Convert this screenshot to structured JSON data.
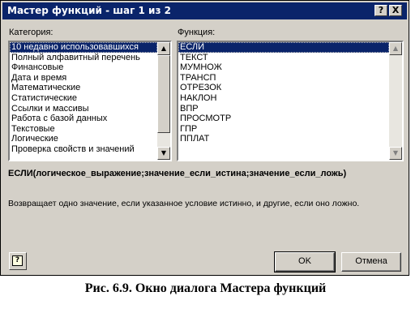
{
  "window": {
    "title": "Мастер функций - шаг 1 из 2",
    "help_glyph": "?",
    "close_glyph": "X"
  },
  "category": {
    "label": "Категория:",
    "items": [
      "10 недавно использовавшихся",
      "Полный алфавитный перечень",
      "Финансовые",
      "Дата и время",
      "Математические",
      "Статистические",
      "Ссылки и массивы",
      "Работа с базой данных",
      "Текстовые",
      "Логические",
      "Проверка свойств и значений"
    ],
    "selected_index": 0
  },
  "function": {
    "label": "Функция:",
    "items": [
      "ЕСЛИ",
      "ТЕКСТ",
      "МУМНОЖ",
      "ТРАНСП",
      "ОТРЕЗОК",
      "НАКЛОН",
      "ВПР",
      "ПРОСМОТР",
      "ГПР",
      "ППЛАТ"
    ],
    "selected_index": 0
  },
  "syntax": "ЕСЛИ(логическое_выражение;значение_если_истина;значение_если_ложь)",
  "description": "Возвращает одно значение, если указанное условие истинно, и другие, если оно ложно.",
  "buttons": {
    "ok": "OK",
    "cancel": "Отмена"
  },
  "caption": "Рис. 6.9. Окно диалога Мастера функций",
  "colors": {
    "titlebar": "#0a246a",
    "dialog_face": "#d4d0c8",
    "selection": "#0a246a"
  }
}
